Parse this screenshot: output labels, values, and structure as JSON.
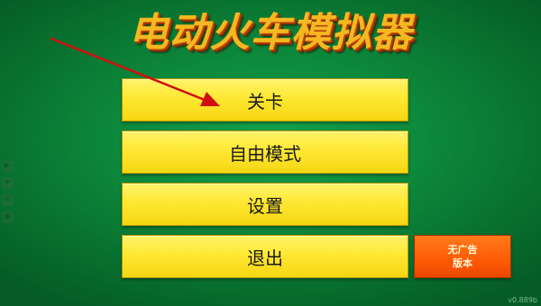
{
  "game": {
    "title": "电动火车模拟器",
    "version": "v0.889b"
  },
  "menu": {
    "levels": "关卡",
    "free_mode": "自由模式",
    "settings": "设置",
    "exit": "退出"
  },
  "promo": {
    "line1": "无广告",
    "line2": "版本"
  },
  "social": {
    "icons": [
      "youtube-icon",
      "telegram-icon",
      "vk-icon",
      "discord-icon"
    ]
  },
  "colors": {
    "background": "#0d8a3c",
    "menu_button": "#ffe833",
    "promo_button": "#ff5a05",
    "title": "#f5b820",
    "arrow": "#d01010"
  }
}
